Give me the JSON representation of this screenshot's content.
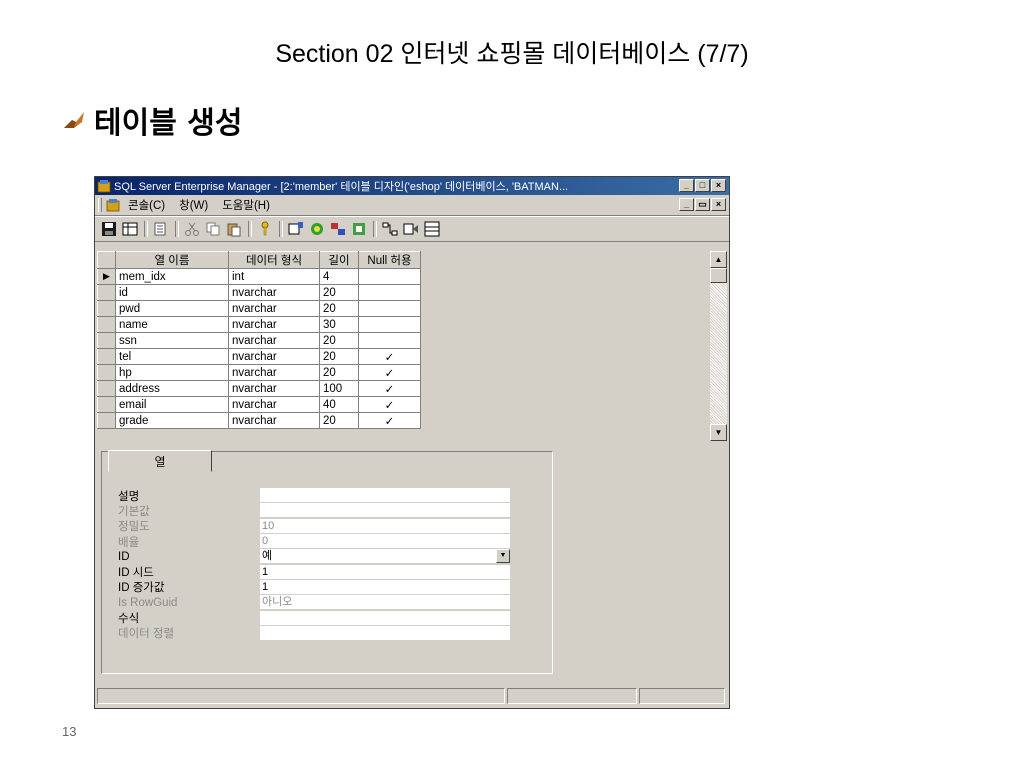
{
  "slide": {
    "title": "Section 02 인터넷 쇼핑몰 데이터베이스 (7/7)",
    "heading": "테이블 생성",
    "page_number": "13"
  },
  "window": {
    "title": "SQL Server Enterprise Manager - [2:'member' 테이블 디자인('eshop' 데이터베이스, 'BATMAN...",
    "menus": [
      "콘솔(C)",
      "창(W)",
      "도움말(H)"
    ]
  },
  "grid": {
    "headers": [
      "열 이름",
      "데이터 형식",
      "길이",
      "Null 허용"
    ],
    "rows": [
      {
        "name": "mem_idx",
        "type": "int",
        "length": "4",
        "null": ""
      },
      {
        "name": "id",
        "type": "nvarchar",
        "length": "20",
        "null": ""
      },
      {
        "name": "pwd",
        "type": "nvarchar",
        "length": "20",
        "null": ""
      },
      {
        "name": "name",
        "type": "nvarchar",
        "length": "30",
        "null": ""
      },
      {
        "name": "ssn",
        "type": "nvarchar",
        "length": "20",
        "null": ""
      },
      {
        "name": "tel",
        "type": "nvarchar",
        "length": "20",
        "null": "✓"
      },
      {
        "name": "hp",
        "type": "nvarchar",
        "length": "20",
        "null": "✓"
      },
      {
        "name": "address",
        "type": "nvarchar",
        "length": "100",
        "null": "✓"
      },
      {
        "name": "email",
        "type": "nvarchar",
        "length": "40",
        "null": "✓"
      },
      {
        "name": "grade",
        "type": "nvarchar",
        "length": "20",
        "null": "✓"
      }
    ]
  },
  "properties": {
    "tab_label": "열",
    "rows": [
      {
        "label": "설명",
        "value": "",
        "disabled": false
      },
      {
        "label": "기본값",
        "value": "",
        "disabled": true
      },
      {
        "label": "정밀도",
        "value": "10",
        "disabled": true
      },
      {
        "label": "배율",
        "value": "0",
        "disabled": true
      },
      {
        "label": "ID",
        "value": "예",
        "disabled": false
      },
      {
        "label": "ID 시드",
        "value": "1",
        "disabled": false
      },
      {
        "label": "ID 증가값",
        "value": "1",
        "disabled": false
      },
      {
        "label": "Is RowGuid",
        "value": "아니오",
        "disabled": true
      },
      {
        "label": "수식",
        "value": "",
        "disabled": false
      },
      {
        "label": "데이터 정렬",
        "value": "",
        "disabled": true
      }
    ]
  },
  "colors": {
    "titlebar_start": "#0a246a",
    "titlebar_end": "#3a6ea5",
    "window_face": "#d4d0c8"
  }
}
